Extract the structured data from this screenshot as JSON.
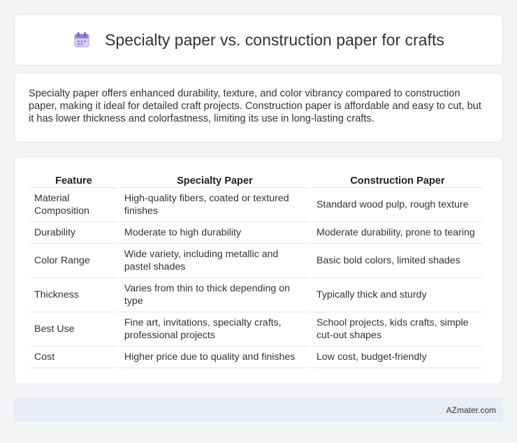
{
  "header": {
    "title": "Specialty paper vs. construction paper for crafts",
    "icon": "calendar-icon"
  },
  "summary": {
    "text": "Specialty paper offers enhanced durability, texture, and color vibrancy compared to construction paper, making it ideal for detailed craft projects. Construction paper is affordable and easy to cut, but it has lower thickness and colorfastness, limiting its use in long-lasting crafts."
  },
  "table": {
    "headers": [
      "Feature",
      "Specialty Paper",
      "Construction Paper"
    ],
    "rows": [
      [
        "Material Composition",
        "High-quality fibers, coated or textured finishes",
        "Standard wood pulp, rough texture"
      ],
      [
        "Durability",
        "Moderate to high durability",
        "Moderate durability, prone to tearing"
      ],
      [
        "Color Range",
        "Wide variety, including metallic and pastel shades",
        "Basic bold colors, limited shades"
      ],
      [
        "Thickness",
        "Varies from thin to thick depending on type",
        "Typically thick and sturdy"
      ],
      [
        "Best Use",
        "Fine art, invitations, specialty crafts, professional projects",
        "School projects, kids crafts, simple cut-out shapes"
      ],
      [
        "Cost",
        "Higher price due to quality and finishes",
        "Low cost, budget-friendly"
      ]
    ]
  },
  "footer": {
    "brand": "AZmater.com"
  }
}
